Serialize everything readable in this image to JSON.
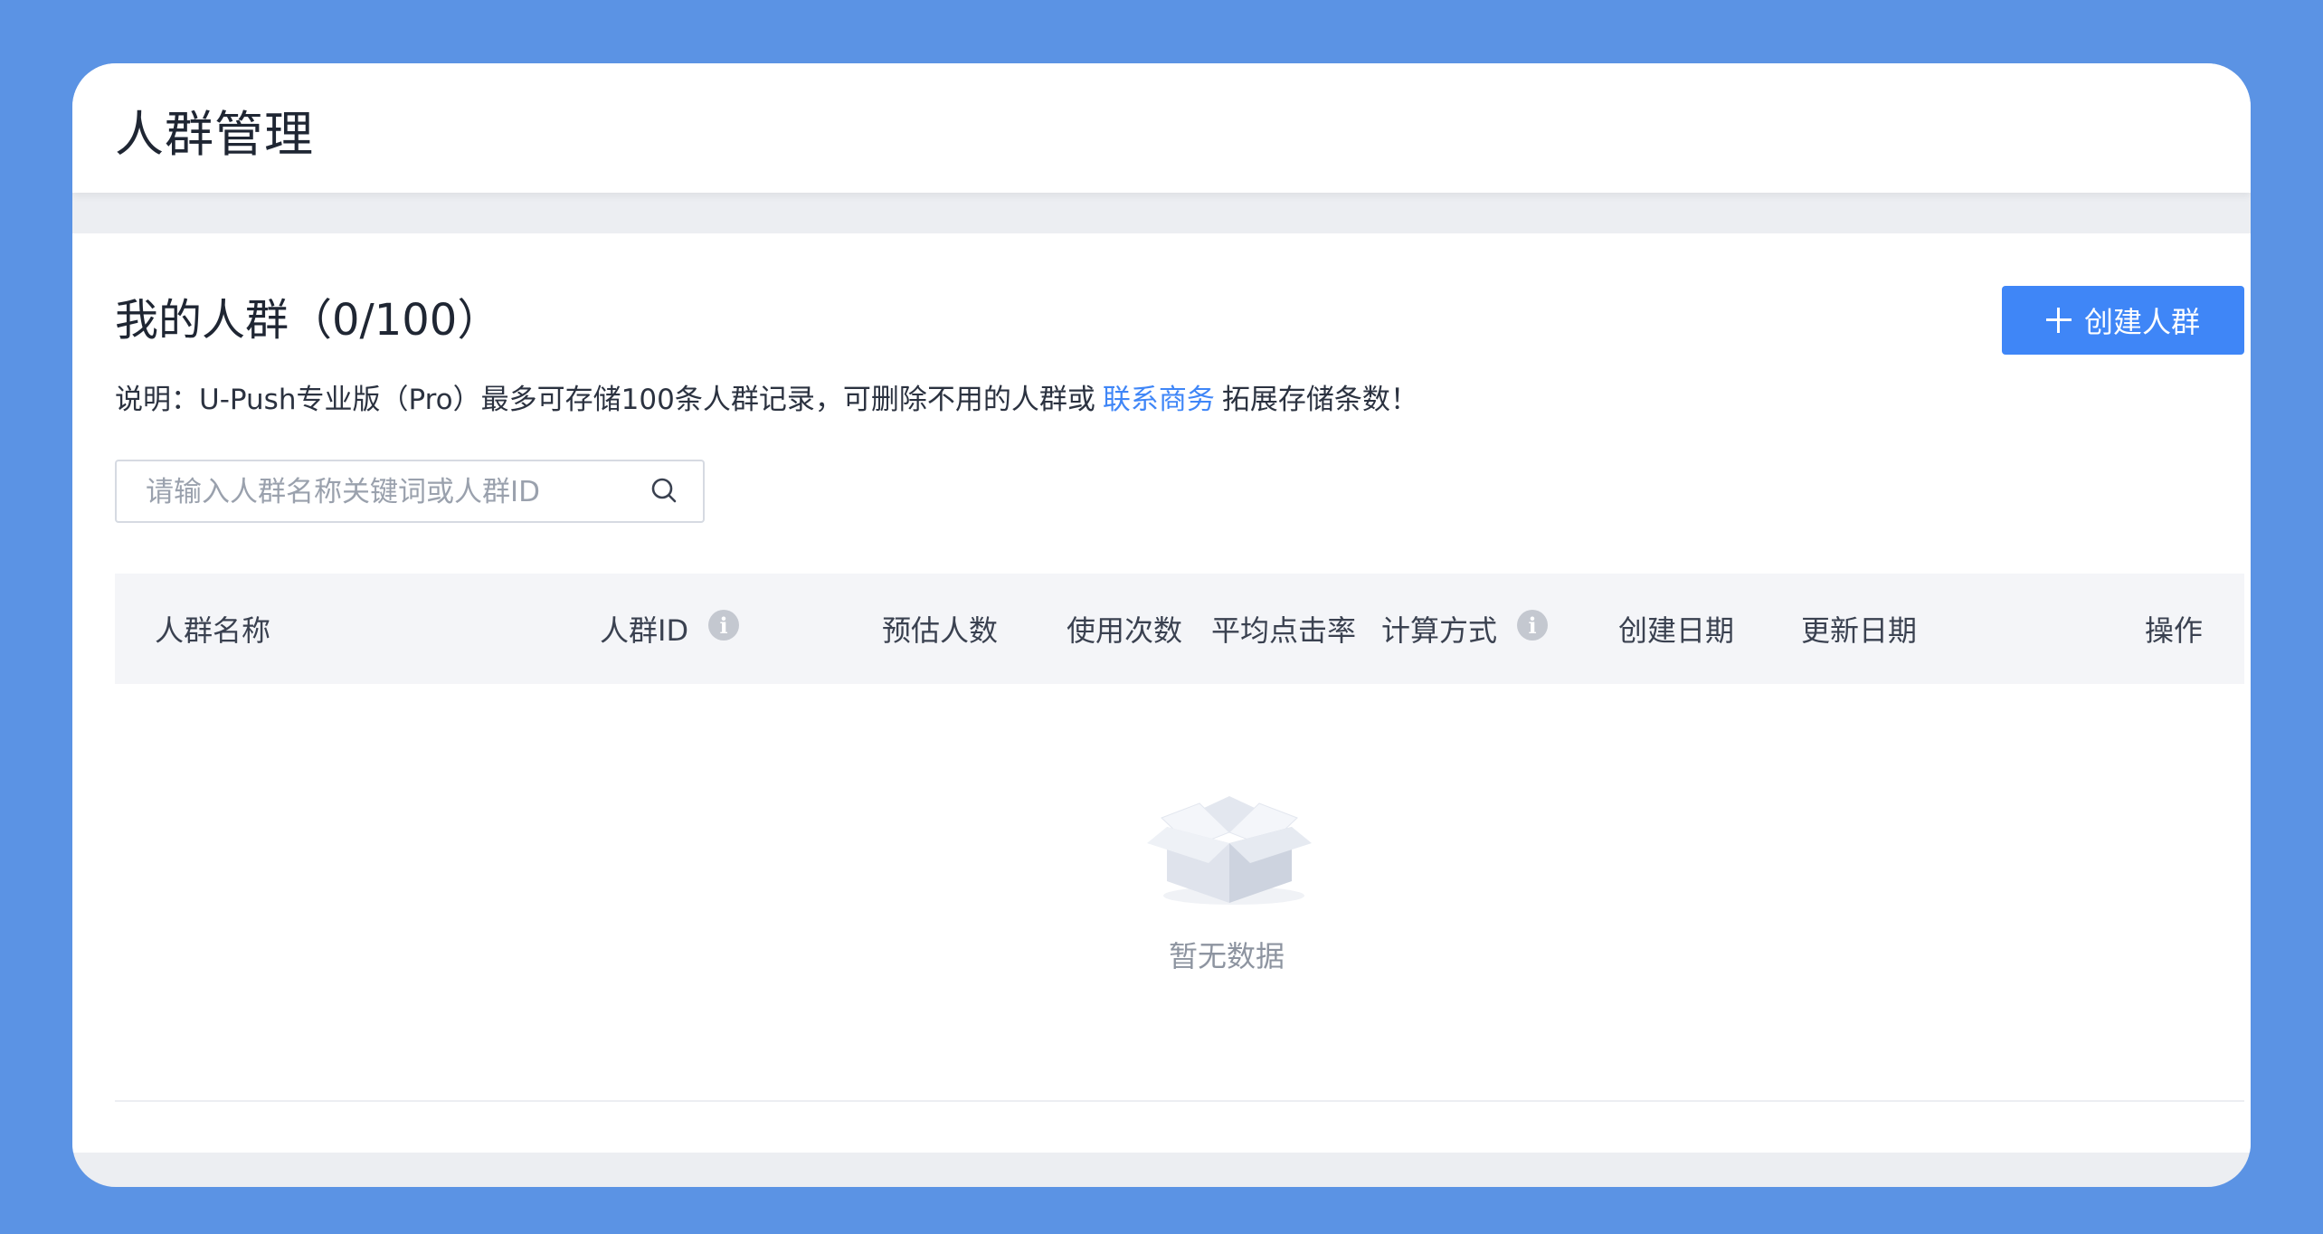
{
  "page": {
    "title": "人群管理"
  },
  "section": {
    "title": "我的人群（0/100）",
    "create_button_label": "创建人群"
  },
  "notice": {
    "prefix": "说明：U-Push专业版（Pro）最多可存储100条人群记录，可删除不用的人群或",
    "link_label": "联系商务",
    "suffix": "拓展存储条数！"
  },
  "search": {
    "placeholder": "请输入人群名称关键词或人群ID",
    "value": ""
  },
  "table": {
    "columns": [
      {
        "label": "人群名称",
        "info": false
      },
      {
        "label": "人群ID",
        "info": true
      },
      {
        "label": "预估人数",
        "info": false
      },
      {
        "label": "使用次数",
        "info": false
      },
      {
        "label": "平均点击率",
        "info": false
      },
      {
        "label": "计算方式",
        "info": true
      },
      {
        "label": "创建日期",
        "info": false
      },
      {
        "label": "更新日期",
        "info": false
      },
      {
        "label": "操作",
        "info": false
      }
    ],
    "rows": [],
    "empty_text": "暂无数据"
  },
  "colors": {
    "background": "#5b93e4",
    "accent": "#3f86f7",
    "text_primary": "#1f2633",
    "text_muted": "#8d94a0"
  },
  "icons": {
    "create": "plus-icon",
    "search": "search-icon",
    "info": "info-icon",
    "empty": "empty-box-icon"
  }
}
